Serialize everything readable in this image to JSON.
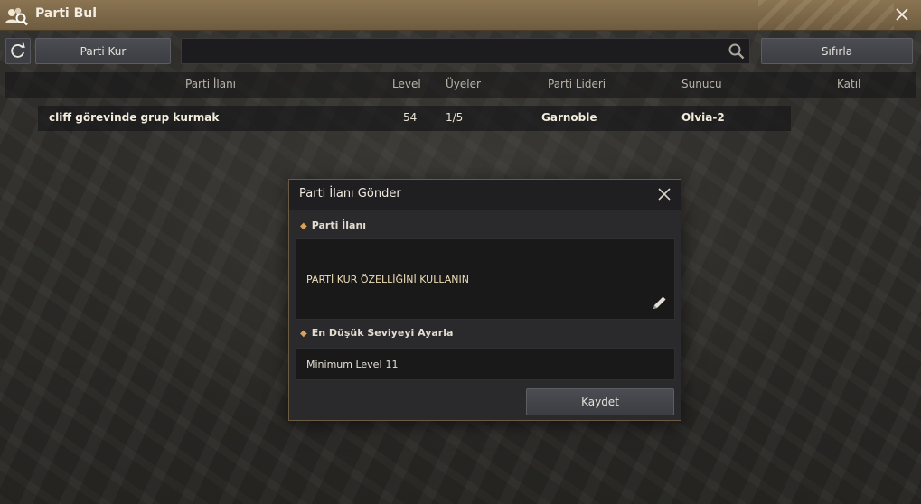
{
  "window": {
    "title": "Parti Bul",
    "title_icon": "party-search-icon",
    "close_icon": "close-icon"
  },
  "toolbar": {
    "refresh_icon": "refresh-icon",
    "create_party_label": "Parti Kur",
    "search_value": "",
    "search_icon": "search-icon",
    "reset_label": "Sıfırla"
  },
  "table": {
    "columns": [
      "Parti İlanı",
      "Level",
      "Üyeler",
      "Parti Lideri",
      "Sunucu",
      "Katıl"
    ],
    "rows": [
      {
        "listing": "cliff görevinde grup kurmak",
        "level": "54",
        "members": "1/5",
        "leader": "Garnoble",
        "server": "Olvia-2",
        "join": ""
      }
    ]
  },
  "modal": {
    "title": "Parti İlanı Gönder",
    "listing_section_label": "Parti İlanı",
    "listing_text": "PARTİ KUR ÖZELLİĞİNİ KULLANIN",
    "edit_icon": "pencil-icon",
    "level_section_label": "En Düşük Seviyeyi Ayarla",
    "min_level_label": "Minimum Level",
    "min_level_value": "11",
    "save_label": "Kaydet"
  },
  "colors": {
    "titlebar": "#7d6849",
    "accent": "#d9a45a",
    "listing_text": "#efdcb5"
  }
}
